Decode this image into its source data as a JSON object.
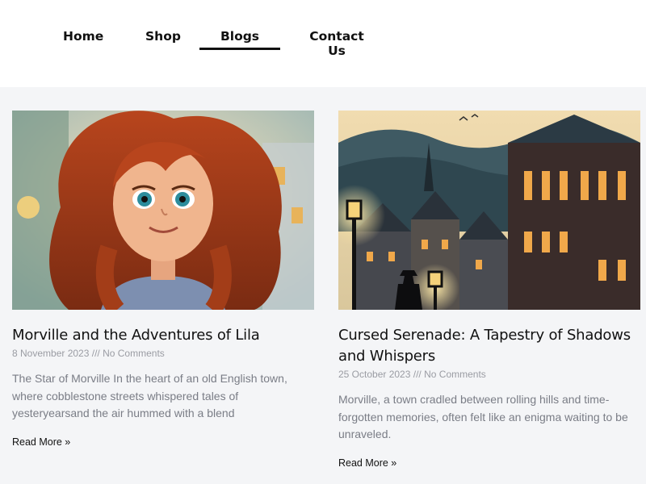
{
  "nav": {
    "items": [
      {
        "label": "Home"
      },
      {
        "label": "Shop"
      },
      {
        "label": "Blogs"
      },
      {
        "label": "Contact Us"
      }
    ],
    "active": "Blogs"
  },
  "posts": [
    {
      "title": "Morville and the Adventures of Lila",
      "date": "8 November 2023",
      "separator": "///",
      "comments": "No Comments",
      "excerpt": "The Star of Morville In the heart of an old English town, where cobblestone streets whispered tales of yesteryearsand the air hummed with a blend",
      "read_more": "Read More »"
    },
    {
      "title": "Cursed Serenade: A Tapestry of Shadows and Whispers",
      "date": "25 October 2023",
      "separator": "///",
      "comments": "No Comments",
      "excerpt": "Morville, a town cradled between rolling hills and time-forgotten memories, often felt like an enigma waiting to be unraveled.",
      "read_more": "Read More »"
    }
  ],
  "colors": {
    "content_bg": "#f4f5f7",
    "meta_text": "#9a9ca3",
    "excerpt_text": "#7a7d86",
    "nav_underline": "#111111"
  }
}
